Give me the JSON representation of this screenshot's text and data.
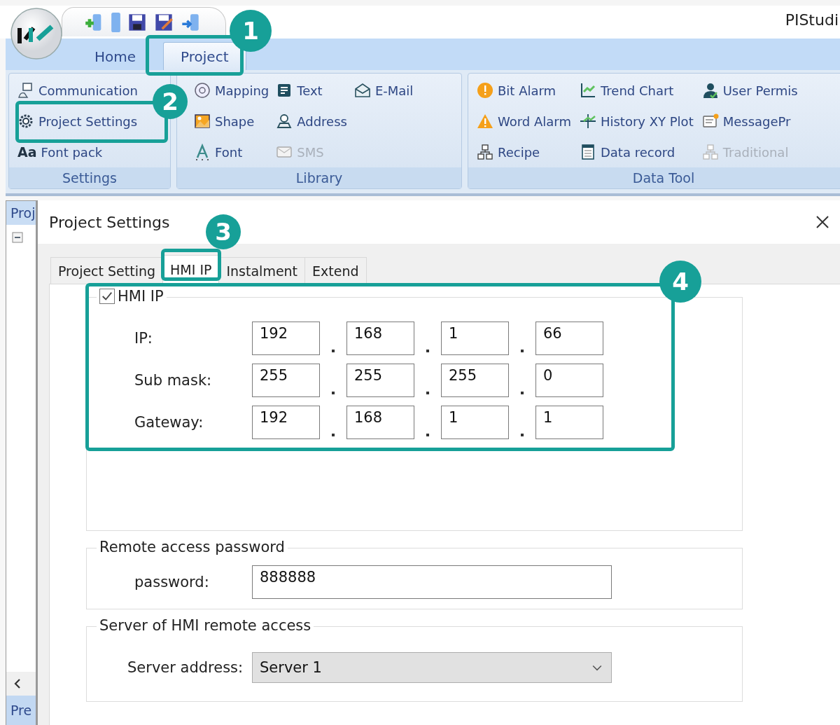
{
  "app_title": "PIStudi",
  "ribbon_tabs": [
    {
      "label": "Home",
      "selected": false
    },
    {
      "label": "Project",
      "selected": true
    }
  ],
  "ribbon_groups": [
    {
      "label": "Settings",
      "columns": [
        [
          {
            "label": "Communication",
            "disabled": false
          },
          {
            "label": "Project Settings",
            "disabled": false
          },
          {
            "label": "Font pack",
            "disabled": false,
            "glyph": "Aa"
          }
        ]
      ]
    },
    {
      "label": "Library",
      "columns": [
        [
          {
            "label": "Mapping",
            "disabled": false
          },
          {
            "label": "Shape",
            "disabled": false
          },
          {
            "label": "Font",
            "disabled": false
          }
        ],
        [
          {
            "label": "Text",
            "disabled": false
          },
          {
            "label": "Address",
            "disabled": false
          },
          {
            "label": "SMS",
            "disabled": true
          }
        ],
        [
          {
            "label": "E-Mail",
            "disabled": false
          }
        ]
      ]
    },
    {
      "label": "Data Tool",
      "columns": [
        [
          {
            "label": "Bit Alarm",
            "disabled": false
          },
          {
            "label": "Word Alarm",
            "disabled": false
          },
          {
            "label": "Recipe",
            "disabled": false
          }
        ],
        [
          {
            "label": "Trend Chart",
            "disabled": false
          },
          {
            "label": "History XY Plot",
            "disabled": false
          },
          {
            "label": "Data record",
            "disabled": false
          }
        ],
        [
          {
            "label": "User Permis",
            "disabled": false
          },
          {
            "label": "MessagePr",
            "disabled": false
          },
          {
            "label": "Traditional",
            "disabled": true
          }
        ]
      ]
    }
  ],
  "side_panel": {
    "header": "Proj",
    "footer": "Pre"
  },
  "dialog": {
    "title": "Project Settings",
    "tabs": [
      {
        "label": "Project Setting",
        "selected": false
      },
      {
        "label": "HMI IP",
        "selected": true
      },
      {
        "label": "Instalment",
        "selected": false
      },
      {
        "label": "Extend",
        "selected": false
      }
    ],
    "hmi_ip": {
      "label": "HMI IP",
      "checked": true,
      "rows": [
        {
          "label": "IP:",
          "octets": [
            "192",
            "168",
            "1",
            "66"
          ]
        },
        {
          "label": "Sub mask:",
          "octets": [
            "255",
            "255",
            "255",
            "0"
          ]
        },
        {
          "label": "Gateway:",
          "octets": [
            "192",
            "168",
            "1",
            "1"
          ]
        }
      ]
    },
    "password_group": {
      "title": "Remote access password",
      "label": "password:",
      "value": "888888"
    },
    "server_group": {
      "title": "Server of HMI remote access",
      "label": "Server address:",
      "value": "Server 1"
    }
  },
  "annotations": [
    {
      "number": "1"
    },
    {
      "number": "2"
    },
    {
      "number": "3"
    },
    {
      "number": "4"
    }
  ]
}
